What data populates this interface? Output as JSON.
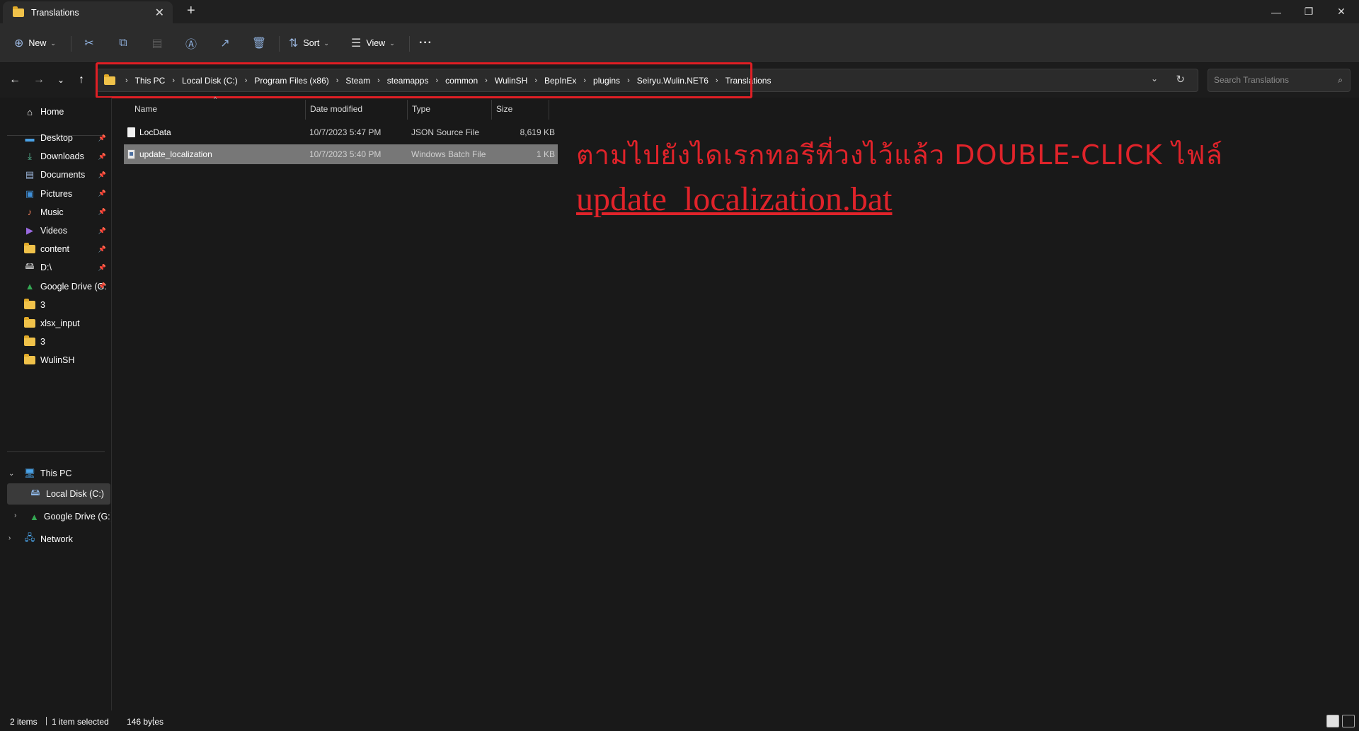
{
  "window": {
    "tab_title": "Translations",
    "new_tab": "+",
    "minimize": "—",
    "maximize": "❐",
    "close": "✕",
    "tab_close": "✕"
  },
  "toolbar": {
    "new_label": "New",
    "sort_label": "Sort",
    "view_label": "View",
    "more_label": "···",
    "icons": [
      "cut-icon",
      "copy-icon",
      "paste-icon",
      "rename-icon",
      "share-icon",
      "delete-icon"
    ]
  },
  "address": {
    "breadcrumbs": [
      "This PC",
      "Local Disk (C:)",
      "Program Files (x86)",
      "Steam",
      "steamapps",
      "common",
      "WulinSH",
      "BepInEx",
      "plugins",
      "Seiryu.Wulin.NET6",
      "Translations"
    ],
    "search_placeholder": "Search Translations"
  },
  "sidebar": {
    "home": "Home",
    "quick_access": [
      {
        "label": "Desktop",
        "icon": "desktop-icon",
        "pinned": true
      },
      {
        "label": "Downloads",
        "icon": "downloads-icon",
        "pinned": true
      },
      {
        "label": "Documents",
        "icon": "documents-icon",
        "pinned": true
      },
      {
        "label": "Pictures",
        "icon": "pictures-icon",
        "pinned": true
      },
      {
        "label": "Music",
        "icon": "music-icon",
        "pinned": true
      },
      {
        "label": "Videos",
        "icon": "videos-icon",
        "pinned": true
      },
      {
        "label": "content",
        "icon": "folder-icon",
        "pinned": true
      },
      {
        "label": "D:\\",
        "icon": "drive-icon",
        "pinned": true
      },
      {
        "label": "Google Drive (G:",
        "icon": "google-drive-icon",
        "pinned": true
      },
      {
        "label": "3",
        "icon": "folder-icon",
        "pinned": false
      },
      {
        "label": "xlsx_input",
        "icon": "folder-icon",
        "pinned": false
      },
      {
        "label": "3",
        "icon": "folder-icon",
        "pinned": false
      },
      {
        "label": "WulinSH",
        "icon": "folder-icon",
        "pinned": false
      }
    ],
    "this_pc": "This PC",
    "local_disk": "Local Disk (C:)",
    "google_drive": "Google Drive (G:)",
    "network": "Network"
  },
  "columns": {
    "name": "Name",
    "date": "Date modified",
    "type": "Type",
    "size": "Size"
  },
  "files": [
    {
      "name": "LocData",
      "date": "10/7/2023 5:47 PM",
      "type": "JSON Source File",
      "size": "8,619 KB",
      "selected": false
    },
    {
      "name": "update_localization",
      "date": "10/7/2023 5:40 PM",
      "type": "Windows Batch File",
      "size": "1 KB",
      "selected": true
    }
  ],
  "annotation": {
    "line1": "ตามไปยังไดเรกทอรีที่วงไว้แล้ว DOUBLE-CLICK ไฟล์",
    "line2": "update_localization.bat",
    "color": "#e0232a"
  },
  "status": {
    "items": "2 items",
    "selected": "1 item selected",
    "size": "146 bytes"
  },
  "colors": {
    "background": "#191919",
    "highlight_box": "#e01f25",
    "folder": "#f0c24a",
    "selected_row": "#777777"
  }
}
